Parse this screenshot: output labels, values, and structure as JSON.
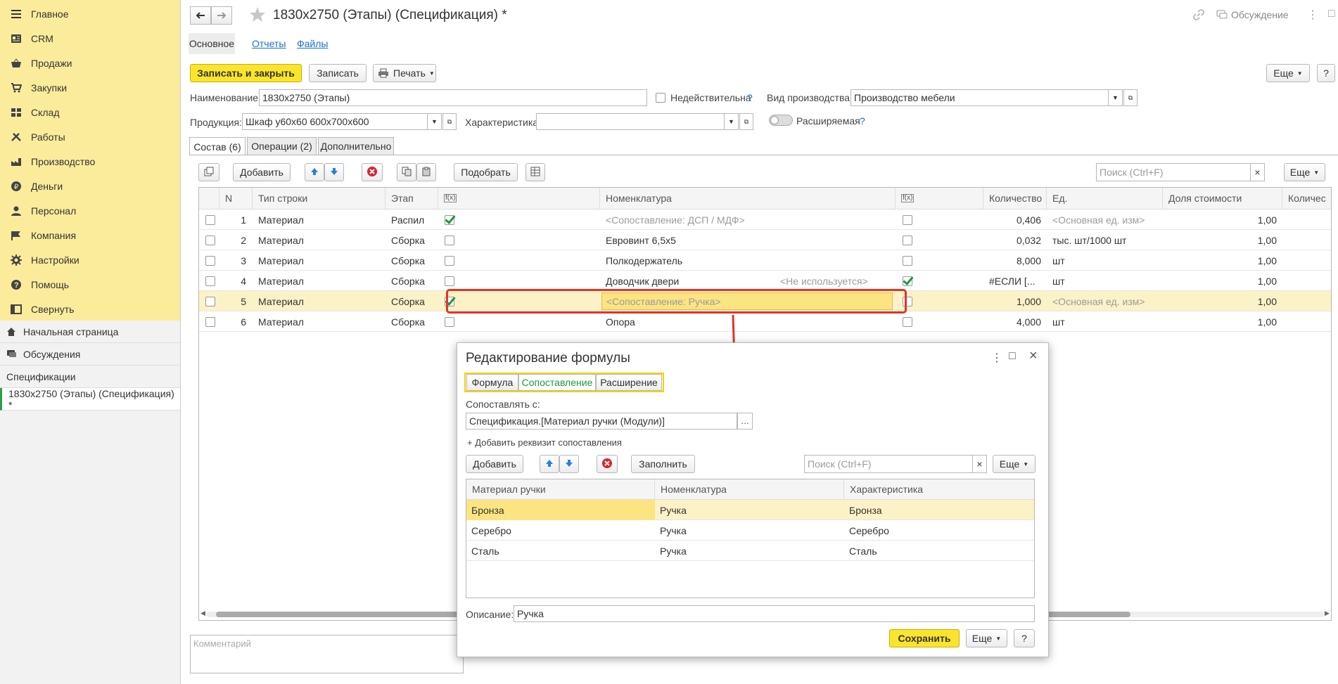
{
  "sidebar": {
    "sections": [
      {
        "label": "Главное",
        "icon": "menu-icon"
      },
      {
        "label": "CRM",
        "icon": "crm-icon"
      },
      {
        "label": "Продажи",
        "icon": "basket-icon"
      },
      {
        "label": "Закупки",
        "icon": "cart-icon"
      },
      {
        "label": "Склад",
        "icon": "warehouse-icon"
      },
      {
        "label": "Работы",
        "icon": "tools-icon"
      },
      {
        "label": "Производство",
        "icon": "factory-icon"
      },
      {
        "label": "Деньги",
        "icon": "money-icon"
      },
      {
        "label": "Персонал",
        "icon": "person-icon"
      },
      {
        "label": "Компания",
        "icon": "flag-icon"
      },
      {
        "label": "Настройки",
        "icon": "gear-icon"
      },
      {
        "label": "Помощь",
        "icon": "help-icon"
      },
      {
        "label": "Свернуть",
        "icon": "collapse-icon"
      }
    ],
    "home": "Начальная страница",
    "discussions": "Обсуждения",
    "open_header": "Спецификации",
    "open_item": "1830х2750 (Этапы) (Спецификация) *"
  },
  "header": {
    "title": "1830х2750 (Этапы) (Спецификация) *",
    "discussion": "Обсуждение",
    "tabs": [
      "Основное",
      "Отчеты",
      "Файлы"
    ]
  },
  "toolbar": {
    "save_close": "Записать и закрыть",
    "save": "Записать",
    "print": "Печать",
    "more": "Еще",
    "help": "?"
  },
  "form": {
    "name_label": "Наименование:",
    "name_value": "1830х2750 (Этапы)",
    "invalid_label": "Недействительна",
    "q": "?",
    "prod_type_label": "Вид производства:",
    "prod_type_value": "Производство мебели",
    "product_label": "Продукция:",
    "product_value": "Шкаф у60х60 600х700х600",
    "char_label": "Характеристика:",
    "char_value": "",
    "extendable_label": "Расширяемая"
  },
  "inner_tabs": [
    "Состав (6)",
    "Операции (2)",
    "Дополнительно"
  ],
  "table_toolbar": {
    "add": "Добавить",
    "pick": "Подобрать",
    "search_placeholder": "Поиск (Ctrl+F)",
    "more": "Еще"
  },
  "table": {
    "headers": [
      "N",
      "Тип строки",
      "Этап",
      "Номенклатура",
      "Количество",
      "Ед.",
      "Доля стоимости",
      "Количес"
    ],
    "rows": [
      {
        "n": "1",
        "type": "Материал",
        "stage": "Распил",
        "f1": true,
        "nom": "<Сопоставление: ДСП / МДФ>",
        "nom_muted": true,
        "note": "",
        "f2": false,
        "qty": "0,406",
        "unit": "<Основная ед. изм>",
        "unit_muted": true,
        "share": "1,00"
      },
      {
        "n": "2",
        "type": "Материал",
        "stage": "Сборка",
        "f1": false,
        "nom": "Евровинт 6,5х5",
        "nom_muted": false,
        "note": "",
        "f2": false,
        "qty": "0,032",
        "unit": "тыс. шт/1000 шт",
        "unit_muted": false,
        "share": "1,00"
      },
      {
        "n": "3",
        "type": "Материал",
        "stage": "Сборка",
        "f1": false,
        "nom": "Полкодержатель",
        "nom_muted": false,
        "note": "",
        "f2": false,
        "qty": "8,000",
        "unit": "шт",
        "unit_muted": false,
        "share": "1,00"
      },
      {
        "n": "4",
        "type": "Материал",
        "stage": "Сборка",
        "f1": false,
        "nom": "Доводчик двери",
        "nom_muted": false,
        "note": "<Не используется>",
        "f2": true,
        "qty": "#ЕСЛИ [...",
        "unit": "шт",
        "unit_muted": false,
        "share": "1,00"
      },
      {
        "n": "5",
        "type": "Материал",
        "stage": "Сборка",
        "f1": true,
        "nom": "<Сопоставление: Ручка>",
        "nom_muted": true,
        "note": "",
        "f2": false,
        "qty": "1,000",
        "unit": "<Основная ед. изм>",
        "unit_muted": true,
        "share": "1,00"
      },
      {
        "n": "6",
        "type": "Материал",
        "stage": "Сборка",
        "f1": false,
        "nom": "Опора",
        "nom_muted": false,
        "note": "",
        "f2": false,
        "qty": "4,000",
        "unit": "шт",
        "unit_muted": false,
        "share": "1,00"
      }
    ]
  },
  "comment_placeholder": "Комментарий",
  "dialog": {
    "title": "Редактирование формулы",
    "tabs": [
      "Формула",
      "Сопоставление",
      "Расширение"
    ],
    "match_label": "Сопоставлять с:",
    "match_value": "Спецификация.[Материал ручки (Модули)]",
    "add_attr": "+ Добавить реквизит сопоставления",
    "add": "Добавить",
    "fill": "Заполнить",
    "search_placeholder": "Поиск (Ctrl+F)",
    "more": "Еще",
    "headers": [
      "Материал ручки",
      "Номенклатура",
      "Характеристика"
    ],
    "rows": [
      [
        "Бронза",
        "Ручка",
        "Бронза"
      ],
      [
        "Серебро",
        "Ручка",
        "Серебро"
      ],
      [
        "Сталь",
        "Ручка",
        "Сталь"
      ]
    ],
    "desc_label": "Описание:",
    "desc_value": "Ручка",
    "save": "Сохранить",
    "help": "?"
  },
  "colors": {
    "accent_yellow": "#fbe52c",
    "sidebar": "#fbec9c",
    "highlight_red": "#e0352b",
    "link": "#1f6fc5",
    "green": "#1c9a3c"
  }
}
